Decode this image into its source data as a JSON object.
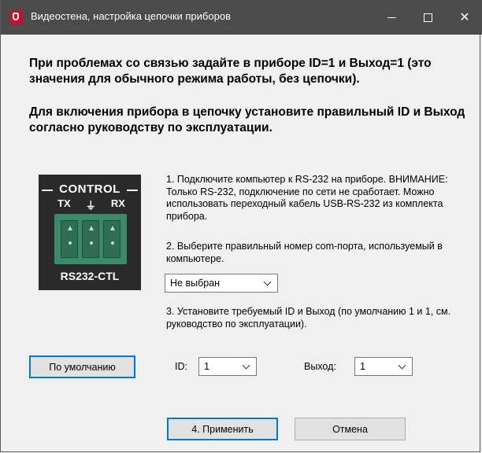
{
  "window": {
    "title": "Видеостена, настройка цепочки приборов"
  },
  "content": {
    "heading1": "При проблемах со связью задайте в приборе ID=1 и Выход=1 (это значения для обычного режима работы, без цепочки).",
    "heading2": "Для включения прибора в цепочку установите правильный ID и Выход согласно руководству по эксплуатации.",
    "step1": "1. Подключите компьютер к RS-232 на приборе. ВНИМАНИЕ: Только RS-232, подключение по сети не сработает. Можно использовать переходный кабель USB-RS-232 из комплекта прибора.",
    "step2": "2. Выберите правильный номер com-порта, используемый в компьютере.",
    "step3": "3. Установите требуемый ID и Выход (по умолчанию 1 и 1, см. руководство по эксплуатации)."
  },
  "connector_image": {
    "control_label": "CONTROL",
    "pin_tx": "TX",
    "pin_ground": "⏚",
    "pin_rx": "RX",
    "port_label": "RS232-CTL"
  },
  "port_select": {
    "value": "Не выбран"
  },
  "id_field": {
    "label": "ID:",
    "value": "1"
  },
  "output_field": {
    "label": "Выход:",
    "value": "1"
  },
  "buttons": {
    "default": "По умолчанию",
    "apply": "4. Применить",
    "cancel": "Отмена"
  },
  "colors": {
    "titlebar": "#4b4b4b",
    "accent": "#0078d7",
    "app_icon": "#c8102e"
  }
}
